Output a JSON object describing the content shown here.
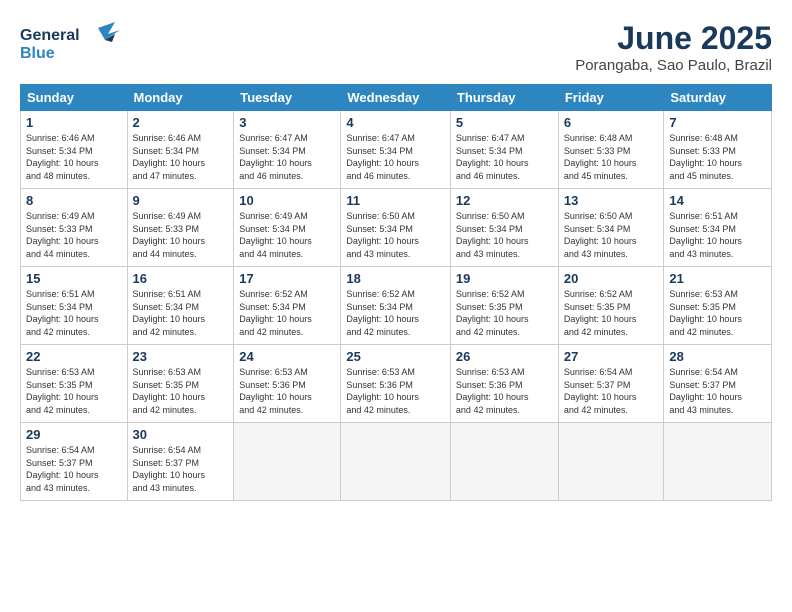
{
  "logo": {
    "line1": "General",
    "line2": "Blue"
  },
  "title": "June 2025",
  "location": "Porangaba, Sao Paulo, Brazil",
  "weekdays": [
    "Sunday",
    "Monday",
    "Tuesday",
    "Wednesday",
    "Thursday",
    "Friday",
    "Saturday"
  ],
  "weeks": [
    [
      {
        "day": "1",
        "info": "Sunrise: 6:46 AM\nSunset: 5:34 PM\nDaylight: 10 hours\nand 48 minutes."
      },
      {
        "day": "2",
        "info": "Sunrise: 6:46 AM\nSunset: 5:34 PM\nDaylight: 10 hours\nand 47 minutes."
      },
      {
        "day": "3",
        "info": "Sunrise: 6:47 AM\nSunset: 5:34 PM\nDaylight: 10 hours\nand 46 minutes."
      },
      {
        "day": "4",
        "info": "Sunrise: 6:47 AM\nSunset: 5:34 PM\nDaylight: 10 hours\nand 46 minutes."
      },
      {
        "day": "5",
        "info": "Sunrise: 6:47 AM\nSunset: 5:34 PM\nDaylight: 10 hours\nand 46 minutes."
      },
      {
        "day": "6",
        "info": "Sunrise: 6:48 AM\nSunset: 5:33 PM\nDaylight: 10 hours\nand 45 minutes."
      },
      {
        "day": "7",
        "info": "Sunrise: 6:48 AM\nSunset: 5:33 PM\nDaylight: 10 hours\nand 45 minutes."
      }
    ],
    [
      {
        "day": "8",
        "info": "Sunrise: 6:49 AM\nSunset: 5:33 PM\nDaylight: 10 hours\nand 44 minutes."
      },
      {
        "day": "9",
        "info": "Sunrise: 6:49 AM\nSunset: 5:33 PM\nDaylight: 10 hours\nand 44 minutes."
      },
      {
        "day": "10",
        "info": "Sunrise: 6:49 AM\nSunset: 5:34 PM\nDaylight: 10 hours\nand 44 minutes."
      },
      {
        "day": "11",
        "info": "Sunrise: 6:50 AM\nSunset: 5:34 PM\nDaylight: 10 hours\nand 43 minutes."
      },
      {
        "day": "12",
        "info": "Sunrise: 6:50 AM\nSunset: 5:34 PM\nDaylight: 10 hours\nand 43 minutes."
      },
      {
        "day": "13",
        "info": "Sunrise: 6:50 AM\nSunset: 5:34 PM\nDaylight: 10 hours\nand 43 minutes."
      },
      {
        "day": "14",
        "info": "Sunrise: 6:51 AM\nSunset: 5:34 PM\nDaylight: 10 hours\nand 43 minutes."
      }
    ],
    [
      {
        "day": "15",
        "info": "Sunrise: 6:51 AM\nSunset: 5:34 PM\nDaylight: 10 hours\nand 42 minutes."
      },
      {
        "day": "16",
        "info": "Sunrise: 6:51 AM\nSunset: 5:34 PM\nDaylight: 10 hours\nand 42 minutes."
      },
      {
        "day": "17",
        "info": "Sunrise: 6:52 AM\nSunset: 5:34 PM\nDaylight: 10 hours\nand 42 minutes."
      },
      {
        "day": "18",
        "info": "Sunrise: 6:52 AM\nSunset: 5:34 PM\nDaylight: 10 hours\nand 42 minutes."
      },
      {
        "day": "19",
        "info": "Sunrise: 6:52 AM\nSunset: 5:35 PM\nDaylight: 10 hours\nand 42 minutes."
      },
      {
        "day": "20",
        "info": "Sunrise: 6:52 AM\nSunset: 5:35 PM\nDaylight: 10 hours\nand 42 minutes."
      },
      {
        "day": "21",
        "info": "Sunrise: 6:53 AM\nSunset: 5:35 PM\nDaylight: 10 hours\nand 42 minutes."
      }
    ],
    [
      {
        "day": "22",
        "info": "Sunrise: 6:53 AM\nSunset: 5:35 PM\nDaylight: 10 hours\nand 42 minutes."
      },
      {
        "day": "23",
        "info": "Sunrise: 6:53 AM\nSunset: 5:35 PM\nDaylight: 10 hours\nand 42 minutes."
      },
      {
        "day": "24",
        "info": "Sunrise: 6:53 AM\nSunset: 5:36 PM\nDaylight: 10 hours\nand 42 minutes."
      },
      {
        "day": "25",
        "info": "Sunrise: 6:53 AM\nSunset: 5:36 PM\nDaylight: 10 hours\nand 42 minutes."
      },
      {
        "day": "26",
        "info": "Sunrise: 6:53 AM\nSunset: 5:36 PM\nDaylight: 10 hours\nand 42 minutes."
      },
      {
        "day": "27",
        "info": "Sunrise: 6:54 AM\nSunset: 5:37 PM\nDaylight: 10 hours\nand 42 minutes."
      },
      {
        "day": "28",
        "info": "Sunrise: 6:54 AM\nSunset: 5:37 PM\nDaylight: 10 hours\nand 43 minutes."
      }
    ],
    [
      {
        "day": "29",
        "info": "Sunrise: 6:54 AM\nSunset: 5:37 PM\nDaylight: 10 hours\nand 43 minutes."
      },
      {
        "day": "30",
        "info": "Sunrise: 6:54 AM\nSunset: 5:37 PM\nDaylight: 10 hours\nand 43 minutes."
      },
      {
        "day": "",
        "info": ""
      },
      {
        "day": "",
        "info": ""
      },
      {
        "day": "",
        "info": ""
      },
      {
        "day": "",
        "info": ""
      },
      {
        "day": "",
        "info": ""
      }
    ]
  ]
}
